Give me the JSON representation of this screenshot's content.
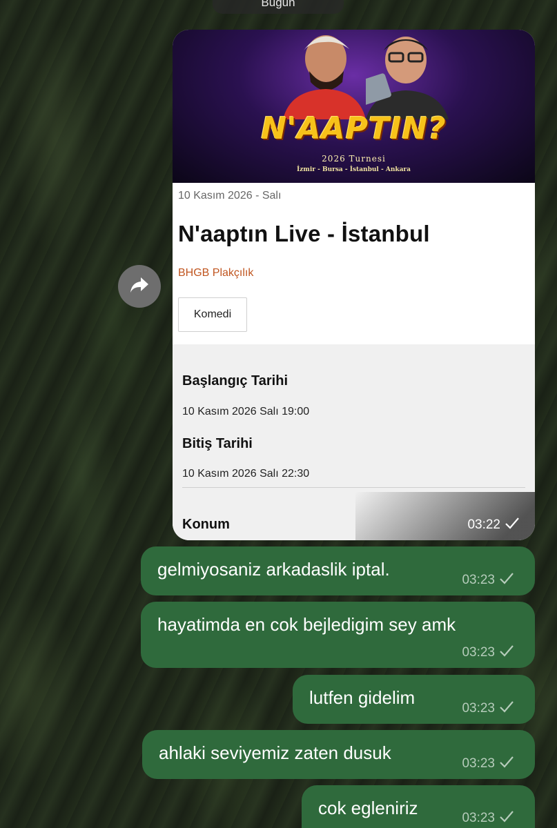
{
  "header": {
    "date_label": "Bugün"
  },
  "event_card": {
    "poster": {
      "title": "N'AAPTIN?",
      "tour": "2026 Turnesi",
      "cities": "İzmir - Bursa - İstanbul - Ankara"
    },
    "date": "10 Kasım 2026 - Salı",
    "title": "N'aaptın Live - İstanbul",
    "organizer": "BHGB Plakçılık",
    "category": "Komedi",
    "start_label": "Başlangıç Tarihi",
    "start_value": "10 Kasım 2026 Salı 19:00",
    "end_label": "Bitiş Tarihi",
    "end_value": "10 Kasım 2026 Salı 22:30",
    "location_label": "Konum",
    "time": "03:22"
  },
  "messages": [
    {
      "text": "gelmiyosaniz arkadaslik iptal.",
      "time": "03:23"
    },
    {
      "text": "hayatimda en cok bejledigim sey amk",
      "time": "03:23"
    },
    {
      "text": "lutfen gidelim",
      "time": "03:23"
    },
    {
      "text": "ahlaki seviyemiz zaten dusuk",
      "time": "03:23"
    },
    {
      "text": "cok egleniriz",
      "time": "03:23"
    }
  ],
  "colors": {
    "bubble": "#2f6a3c",
    "organizer": "#c0551f",
    "forward_button": "#6e6e6e"
  },
  "icons": [
    "forward-icon",
    "checkmark-icon"
  ]
}
